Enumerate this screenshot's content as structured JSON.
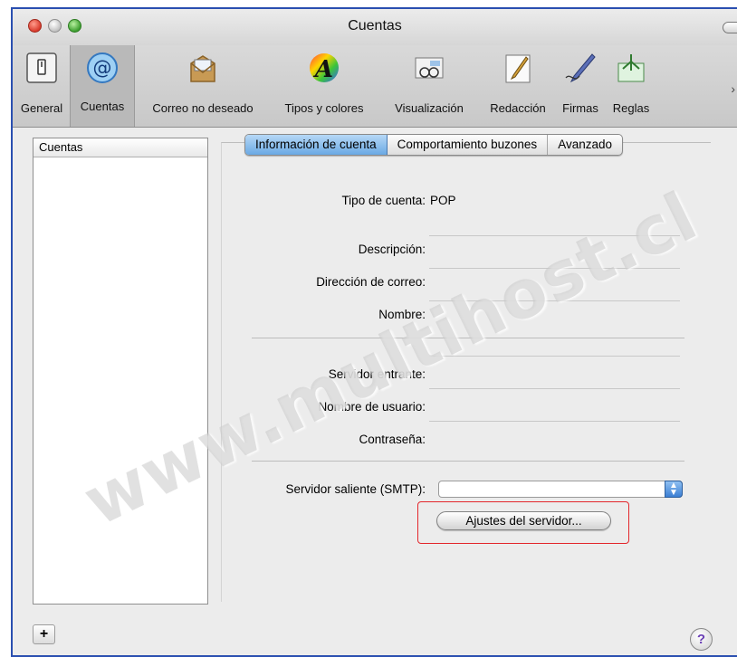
{
  "window": {
    "title": "Cuentas"
  },
  "toolbar": {
    "items": [
      {
        "label": "General",
        "icon": "switch-icon"
      },
      {
        "label": "Cuentas",
        "icon": "at-sign-icon"
      },
      {
        "label": "Correo no deseado",
        "icon": "junk-mail-icon"
      },
      {
        "label": "Tipos y colores",
        "icon": "fonts-colors-icon"
      },
      {
        "label": "Visualización",
        "icon": "viewing-icon"
      },
      {
        "label": "Redacción",
        "icon": "composing-icon"
      },
      {
        "label": "Firmas",
        "icon": "signature-icon"
      },
      {
        "label": "Reglas",
        "icon": "rules-icon"
      }
    ],
    "selected": "Cuentas"
  },
  "sidebar": {
    "header": "Cuentas",
    "add_label": "+"
  },
  "tabs": [
    "Información de cuenta",
    "Comportamiento buzones",
    "Avanzado"
  ],
  "form": {
    "account_type_label": "Tipo de cuenta:",
    "account_type_value": "POP",
    "description_label": "Descripción:",
    "email_label": "Dirección de correo:",
    "name_label": "Nombre:",
    "incoming_label": "Servidor entrante:",
    "username_label": "Nombre de usuario:",
    "password_label": "Contraseña:",
    "smtp_label": "Servidor saliente (SMTP):",
    "server_settings_button": "Ajustes del servidor..."
  },
  "help_label": "?",
  "watermark": "www.multihost.cl",
  "colors": {
    "frame": "#2a4fb0",
    "highlight": "#e3262b",
    "tab_active": "#6aa9e4"
  }
}
